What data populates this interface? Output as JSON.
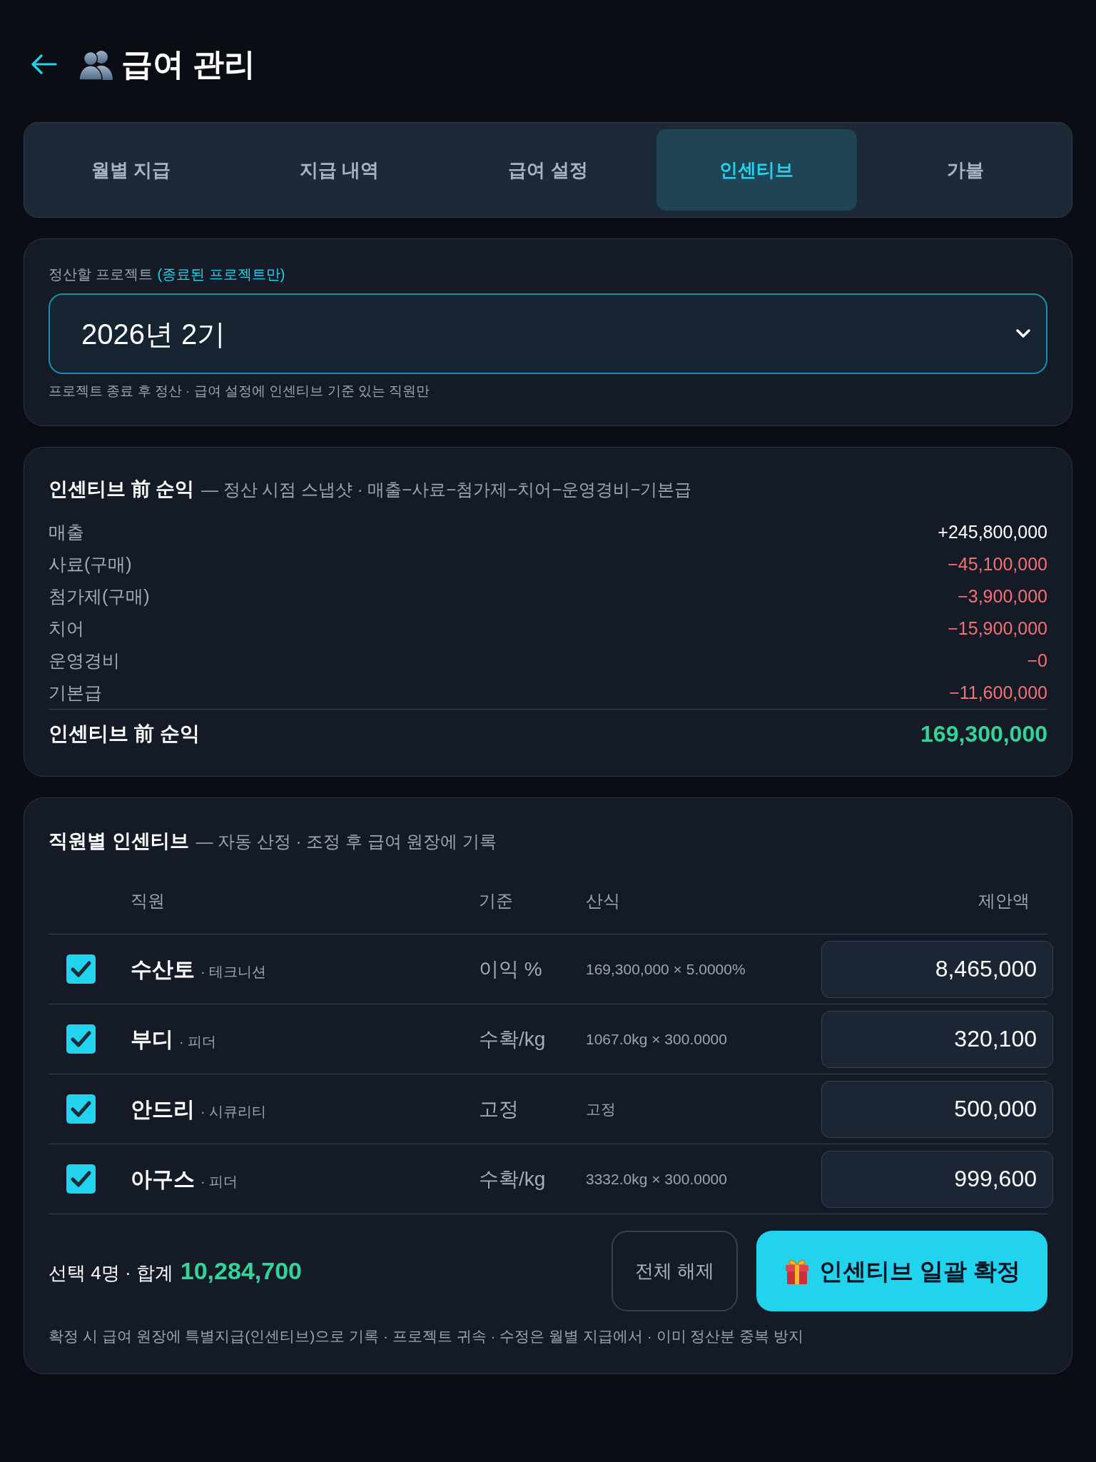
{
  "header": {
    "title": "급여 관리"
  },
  "tabs": [
    {
      "label": "월별 지급",
      "selected": false
    },
    {
      "label": "지급 내역",
      "selected": false
    },
    {
      "label": "급여 설정",
      "selected": false
    },
    {
      "label": "인센티브",
      "selected": true
    },
    {
      "label": "가불",
      "selected": false
    }
  ],
  "project": {
    "label": "정산할 프로젝트",
    "label_note": "(종료된 프로젝트만)",
    "value": "2026년 2기",
    "hint": "프로젝트 종료 후 정산 · 급여 설정에 인센티브 기준 있는 직원만"
  },
  "profit": {
    "title": "인센티브 前 순익",
    "subtitle": "— 정산 시점 스냅샷 · 매출−사료−첨가제−치어−운영경비−기본급",
    "rows": [
      {
        "label": "매출",
        "amount": "+245,800,000",
        "kind": "income"
      },
      {
        "label": "사료(구매)",
        "amount": "−45,100,000",
        "kind": "expense"
      },
      {
        "label": "첨가제(구매)",
        "amount": "−3,900,000",
        "kind": "expense"
      },
      {
        "label": "치어",
        "amount": "−15,900,000",
        "kind": "expense"
      },
      {
        "label": "운영경비",
        "amount": "−0",
        "kind": "expense"
      },
      {
        "label": "기본급",
        "amount": "−11,600,000",
        "kind": "expense"
      }
    ],
    "total": {
      "label": "인센티브 前 순익",
      "amount": "169,300,000"
    }
  },
  "incentives": {
    "title": "직원별 인센티브",
    "subtitle": "— 자동 산정 · 조정 후 급여 원장에 기록",
    "columns": [
      "직원",
      "기준",
      "산식",
      "제안액"
    ],
    "rows": [
      {
        "checked": true,
        "name": "수산토",
        "role": "· 테크니션",
        "basis": "이익 %",
        "formula": "169,300,000 × 5.0000%",
        "amount": "8,465,000"
      },
      {
        "checked": true,
        "name": "부디",
        "role": "· 피더",
        "basis": "수확/kg",
        "formula": "1067.0kg × 300.0000",
        "amount": "320,100"
      },
      {
        "checked": true,
        "name": "안드리",
        "role": "· 시큐리티",
        "basis": "고정",
        "formula": "고정",
        "amount": "500,000"
      },
      {
        "checked": true,
        "name": "아구스",
        "role": "· 피더",
        "basis": "수확/kg",
        "formula": "3332.0kg × 300.0000",
        "amount": "999,600"
      }
    ],
    "summary": {
      "label": "선택 4명 · 합계",
      "total": "10,284,700"
    },
    "buttons": [
      {
        "label": "전체 해제",
        "kind": "secondary"
      },
      {
        "label": "인센티브 일괄 확정",
        "kind": "primary"
      }
    ],
    "note": "확정 시 급여 원장에 특별지급(인센티브)으로 기록 · 프로젝트 귀속 · 수정은 월별 지급에서 · 이미 정산분 중복 방지"
  }
}
